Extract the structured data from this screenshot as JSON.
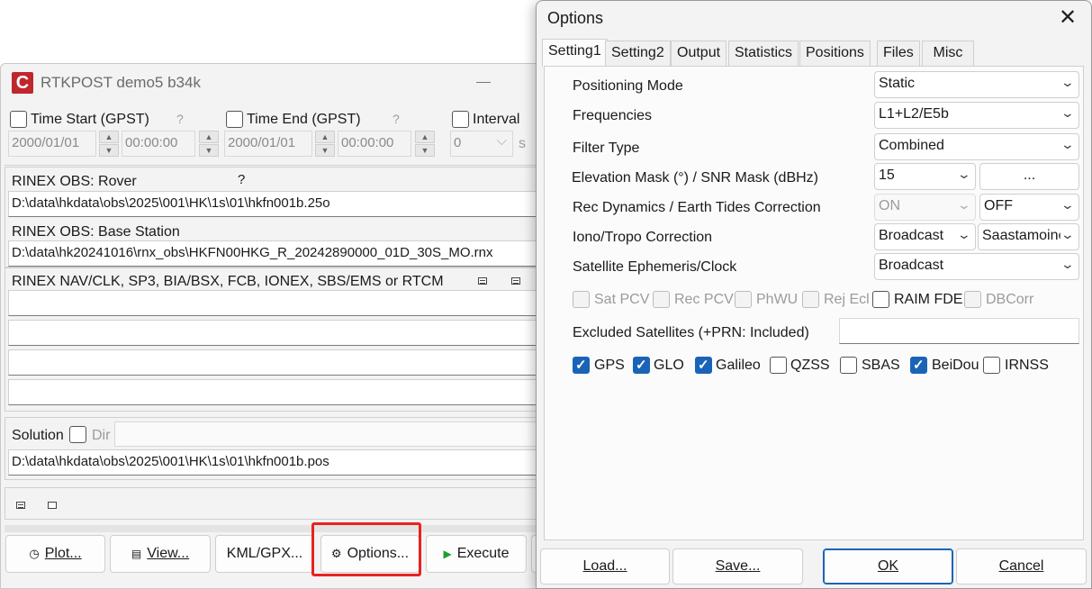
{
  "main": {
    "title": "RTKPOST demo5 b34k",
    "icon_letter": "C",
    "time_start_label": "Time Start (GPST)",
    "time_end_label": "Time End (GPST)",
    "interval_label": "Interval",
    "help_mark": "?",
    "start_date": "2000/01/01",
    "start_time": "00:00:00",
    "end_date": "2000/01/01",
    "end_time": "00:00:00",
    "interval_value": "0",
    "interval_unit": "s",
    "rover_label": "RINEX OBS: Rover",
    "rover_path": "D:\\data\\hkdata\\obs\\2025\\001\\HK\\1s\\01\\hkfn001b.25o",
    "base_label": "RINEX OBS: Base Station",
    "base_path": "D:\\data\\hk20241016\\rnx_obs\\HKFN00HKG_R_20242890000_01D_30S_MO.rnx",
    "nav_label": "RINEX NAV/CLK, SP3, BIA/BSX, FCB, IONEX, SBS/EMS  or RTCM",
    "nav_fields": [
      "",
      "",
      "",
      ""
    ],
    "solution_label": "Solution",
    "dir_label": "Dir",
    "solution_path": "D:\\data\\hkdata\\obs\\2025\\001\\HK\\1s\\01\\hkfn001b.pos",
    "buttons": {
      "plot": "Plot...",
      "view": "View...",
      "kml": "KML/GPX...",
      "options": "Options...",
      "execute": "Execute"
    }
  },
  "dialog": {
    "title": "Options",
    "tabs": [
      "Setting1",
      "Setting2",
      "Output",
      "Statistics",
      "Positions",
      "Files",
      "Misc"
    ],
    "active_tab": "Setting1",
    "rows": {
      "positioning_mode_label": "Positioning Mode",
      "positioning_mode_value": "Static",
      "frequencies_label": "Frequencies",
      "frequencies_value": "L1+L2/E5b",
      "filter_type_label": "Filter Type",
      "filter_type_value": "Combined",
      "elevation_label": "Elevation Mask (°) / SNR Mask (dBHz)",
      "elevation_value": "15",
      "snr_button": "...",
      "rec_dyn_label": "Rec Dynamics / Earth Tides Correction",
      "rec_dyn_value": "ON",
      "earth_tides_value": "OFF",
      "iono_tropo_label": "Iono/Tropo Correction",
      "iono_value": "Broadcast",
      "tropo_value": "Saastamoinen",
      "ephemeris_label": "Satellite Ephemeris/Clock",
      "ephemeris_value": "Broadcast"
    },
    "options_checks": [
      {
        "label": "Sat PCV",
        "checked": false,
        "enabled": false
      },
      {
        "label": "Rec PCV",
        "checked": false,
        "enabled": false
      },
      {
        "label": "PhWU",
        "checked": false,
        "enabled": false
      },
      {
        "label": "Rej Ecl",
        "checked": false,
        "enabled": false
      },
      {
        "label": "RAIM FDE",
        "checked": false,
        "enabled": true
      },
      {
        "label": "DBCorr",
        "checked": false,
        "enabled": false
      }
    ],
    "excluded_label": "Excluded Satellites (+PRN: Included)",
    "excluded_value": "",
    "systems": [
      {
        "label": "GPS",
        "checked": true
      },
      {
        "label": "GLO",
        "checked": true
      },
      {
        "label": "Galileo",
        "checked": true
      },
      {
        "label": "QZSS",
        "checked": false
      },
      {
        "label": "SBAS",
        "checked": false
      },
      {
        "label": "BeiDou",
        "checked": true
      },
      {
        "label": "IRNSS",
        "checked": false
      }
    ],
    "buttons": {
      "load": "Load...",
      "save": "Save...",
      "ok": "OK",
      "cancel": "Cancel"
    }
  }
}
